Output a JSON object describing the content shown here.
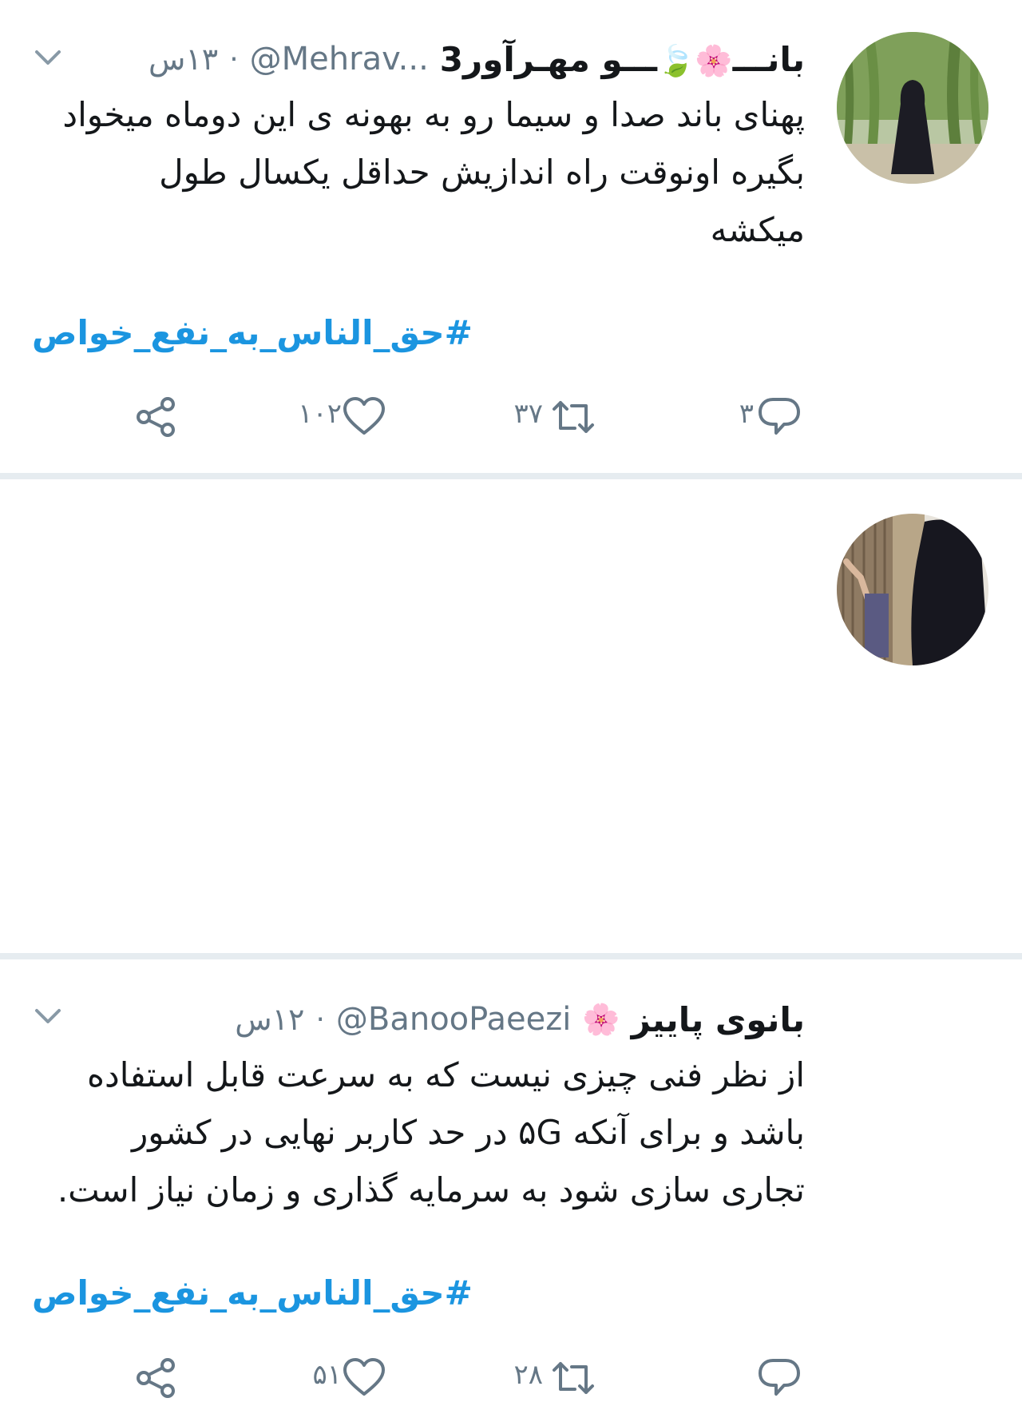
{
  "colors": {
    "text": "#14171a",
    "secondary": "#657786",
    "hashtag": "#1b95e0",
    "separator": "#e6ecf0"
  },
  "tweets": [
    {
      "display_name_start": "بانـــ",
      "display_name_mid": "ـــو مهـرآور3",
      "flower_emoji": "🌸",
      "leaf_emoji": "🍃",
      "handle": "@Mehrav...",
      "separator": "·",
      "time": "۱۳س",
      "body": "پهنای باند صدا و سیما رو به بهونه ی این دوماه میخواد بگیره اونوقت راه اندازیش حداقل یکسال طول میکشه",
      "hashtag": "#حق_الناس_به_نفع_خواص",
      "reply_count": "۳",
      "retweet_count": "۳۷",
      "like_count": "۱۰۲",
      "avatar_icon": "woman-in-chador-among-willow-trees"
    },
    {
      "display_name": "بانوی پاییز",
      "flower_emoji": "🌸",
      "handle": "@BanooPaeezi",
      "separator": "·",
      "time": "۱۲س",
      "body": "از نظر فنی چیزی نیست که به سرعت قابل استفاده باشد و برای آنکه ۵G در حد کاربر نهایی در کشور تجاری سازی شود به سرمایه گذاری و زمان نیاز است.",
      "hashtag": "#حق_الناس_به_نفع_خواص",
      "reply_count": "",
      "retweet_count": "۲۸",
      "like_count": "۵۱",
      "avatar_icon": "woman-in-chador-by-wooden-door"
    }
  ]
}
